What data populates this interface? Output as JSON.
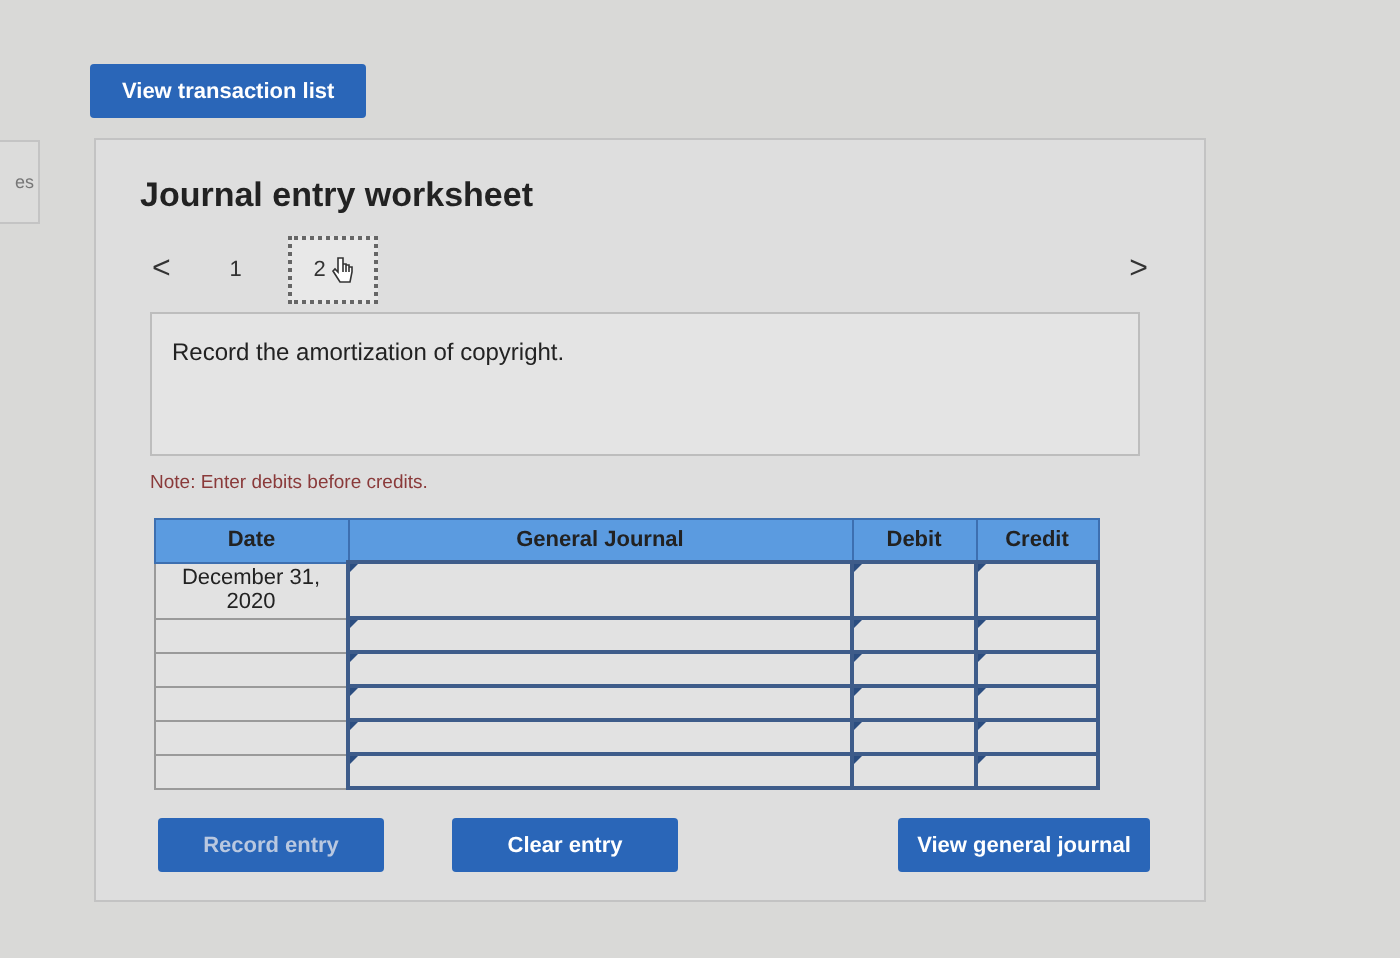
{
  "side_tab": {
    "label": "es"
  },
  "transaction_button": {
    "label": "View transaction list"
  },
  "worksheet": {
    "title": "Journal entry worksheet",
    "pager": {
      "prev": "<",
      "next": ">",
      "pages": [
        {
          "label": "1",
          "selected": false
        },
        {
          "label": "2",
          "selected": true
        }
      ]
    },
    "prompt": "Record the amortization of copyright.",
    "note": "Note: Enter debits before credits.",
    "table": {
      "columns": [
        "Date",
        "General Journal",
        "Debit",
        "Credit"
      ],
      "rows": [
        {
          "date": "December 31, 2020"
        },
        {
          "date": ""
        },
        {
          "date": ""
        },
        {
          "date": ""
        },
        {
          "date": ""
        },
        {
          "date": ""
        }
      ]
    },
    "buttons": [
      {
        "label": "Record entry",
        "disabled": true
      },
      {
        "label": "Clear entry",
        "disabled": false
      },
      {
        "label": "View general journal",
        "disabled": false
      }
    ]
  }
}
